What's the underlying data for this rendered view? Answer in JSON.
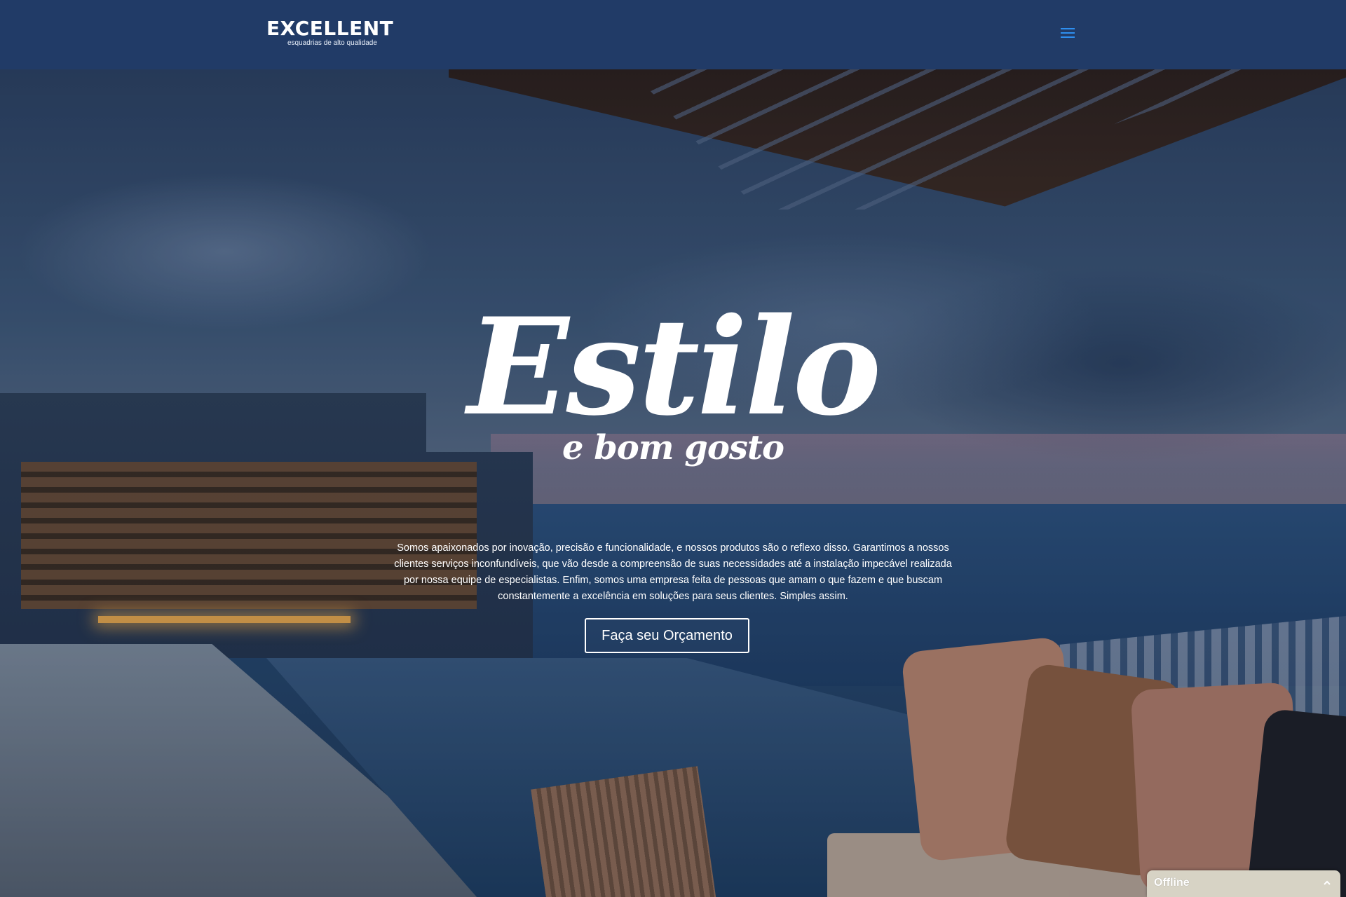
{
  "header": {
    "logo_wordmark": "EXCELLENT",
    "logo_tagline": "esquadrias de alto qualidade",
    "menu_icon": "hamburger-menu-icon",
    "accent_color": "#2e8ff0",
    "background_color": "#213b67"
  },
  "hero": {
    "title": "Estilo",
    "subtitle": "e bom gosto",
    "intro": "Somos apaixonados por inovação, precisão e funcionalidade, e nossos produtos são o reflexo disso. Garantimos a nossos clientes serviços inconfundíveis, que vão desde a compreensão de suas necessidades até a instalação impecável realizada por nossa equipe de especialistas. Enfim, somos uma empresa feita de pessoas que amam o que fazem e que buscam constantemente a excelência em soluções para seus clientes. Simples assim.",
    "cta_label": "Faça seu Orçamento"
  },
  "chat": {
    "status": "Offline",
    "toggle_icon": "chevron-up-icon"
  }
}
